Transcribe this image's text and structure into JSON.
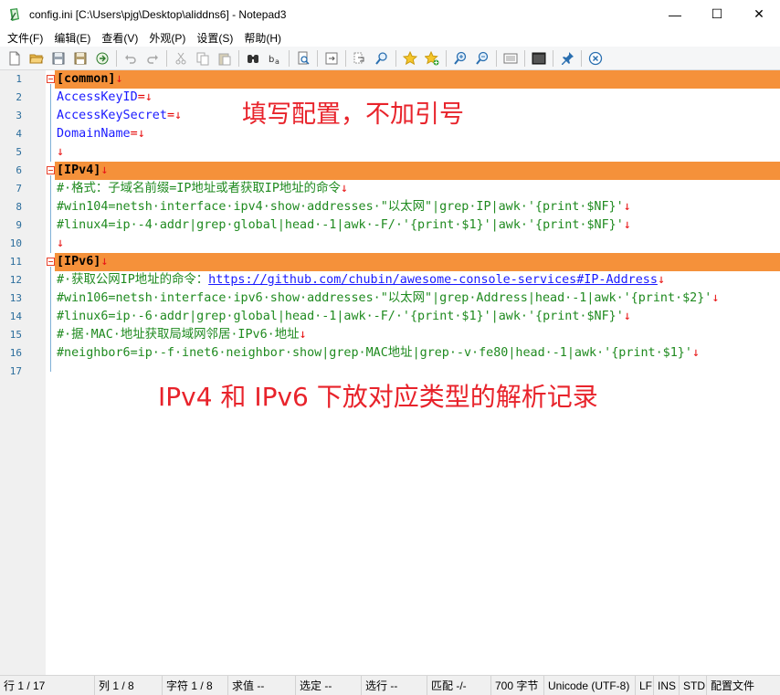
{
  "window": {
    "title": "config.ini [C:\\Users\\pjg\\Desktop\\aliddns6] - Notepad3",
    "minimize_glyph": "—",
    "maximize_glyph": "☐",
    "close_glyph": "✕"
  },
  "menu": [
    "文件(F)",
    "编辑(E)",
    "查看(V)",
    "外观(P)",
    "设置(S)",
    "帮助(H)"
  ],
  "toolbar_icons": [
    "new-file-icon",
    "open-folder-icon",
    "save-icon",
    "save-as-icon",
    "browse-icon",
    "undo-icon",
    "redo-icon",
    "cut-icon",
    "copy-icon",
    "paste-icon",
    "find-icon",
    "replace-icon",
    "search-doc-icon",
    "goto-icon",
    "word-wrap-icon",
    "zoom-find-icon",
    "favorites-icon",
    "add-favorite-icon",
    "zoom-in-icon",
    "zoom-out-icon",
    "schemes-icon",
    "console-icon",
    "pin-icon",
    "close-file-icon"
  ],
  "lines": [
    {
      "n": "1",
      "parts": [
        [
          "sec",
          "[common]"
        ],
        [
          "crlf",
          "↓"
        ]
      ]
    },
    {
      "n": "2",
      "parts": [
        [
          "key",
          "AccessKeyID"
        ],
        [
          "eq",
          "="
        ],
        [
          "crlf",
          "↓"
        ]
      ]
    },
    {
      "n": "3",
      "parts": [
        [
          "key",
          "AccessKeySecret"
        ],
        [
          "eq",
          "="
        ],
        [
          "crlf",
          "↓"
        ]
      ]
    },
    {
      "n": "4",
      "parts": [
        [
          "key",
          "DomainName"
        ],
        [
          "eq",
          "="
        ],
        [
          "crlf",
          "↓"
        ]
      ]
    },
    {
      "n": "5",
      "parts": [
        [
          "crlf",
          "↓"
        ]
      ]
    },
    {
      "n": "6",
      "parts": [
        [
          "sec",
          "[IPv4]"
        ],
        [
          "crlf",
          "↓"
        ]
      ]
    },
    {
      "n": "7",
      "parts": [
        [
          "cmt",
          "#·格式：子域名前缀=IP地址或者获取IP地址的命令"
        ],
        [
          "crlf",
          "↓"
        ]
      ]
    },
    {
      "n": "8",
      "parts": [
        [
          "cmt",
          "#win104=netsh·interface·ipv4·show·addresses·\"以太网\"|grep·IP|awk·'{print·$NF}'"
        ],
        [
          "crlf",
          "↓"
        ]
      ]
    },
    {
      "n": "9",
      "parts": [
        [
          "cmt",
          "#linux4=ip·-4·addr|grep·global|head·-1|awk·-F/·'{print·$1}'|awk·'{print·$NF}'"
        ],
        [
          "crlf",
          "↓"
        ]
      ]
    },
    {
      "n": "10",
      "parts": [
        [
          "crlf",
          "↓"
        ]
      ]
    },
    {
      "n": "11",
      "parts": [
        [
          "sec",
          "[IPv6]"
        ],
        [
          "crlf",
          "↓"
        ]
      ]
    },
    {
      "n": "12",
      "parts": [
        [
          "cmt",
          "#·获取公网IP地址的命令："
        ],
        [
          "link",
          "https://github.com/chubin/awesome-console-services#IP-Address"
        ],
        [
          "crlf",
          "↓"
        ]
      ]
    },
    {
      "n": "13",
      "parts": [
        [
          "cmt",
          "#win106=netsh·interface·ipv6·show·addresses·\"以太网\"|grep·Address|head·-1|awk·'{print·$2}'"
        ],
        [
          "crlf",
          "↓"
        ]
      ]
    },
    {
      "n": "14",
      "parts": [
        [
          "cmt",
          "#linux6=ip·-6·addr|grep·global|head·-1|awk·-F/·'{print·$1}'|awk·'{print·$NF}'"
        ],
        [
          "crlf",
          "↓"
        ]
      ]
    },
    {
      "n": "15",
      "parts": [
        [
          "cmt",
          "#·据·MAC·地址获取局域网邻居·IPv6·地址"
        ],
        [
          "crlf",
          "↓"
        ]
      ]
    },
    {
      "n": "16",
      "parts": [
        [
          "cmt",
          "#neighbor6=ip·-f·inet6·neighbor·show|grep·MAC地址|grep·-v·fe80|head·-1|awk·'{print·$1}'"
        ],
        [
          "crlf",
          "↓"
        ]
      ]
    },
    {
      "n": "17",
      "parts": []
    }
  ],
  "notes": {
    "top": "填写配置，不加引号",
    "bottom": "IPv4 和 IPv6 下放对应类型的解析记录"
  },
  "status": [
    "行  1 / 17",
    "列  1 / 8",
    "字符  1 / 8",
    "求值  --",
    "选定  --",
    "选行  --",
    "匹配  -/-",
    "700 字节",
    "Unicode (UTF-8)",
    "LF",
    "INS",
    "STD",
    "配置文件"
  ],
  "colors": {
    "section_highlight": "#f5913a",
    "key": "#1a1aff",
    "comment": "#1f8a1f",
    "line_number": "#2b6d9c",
    "annotation": "#e8232b"
  }
}
